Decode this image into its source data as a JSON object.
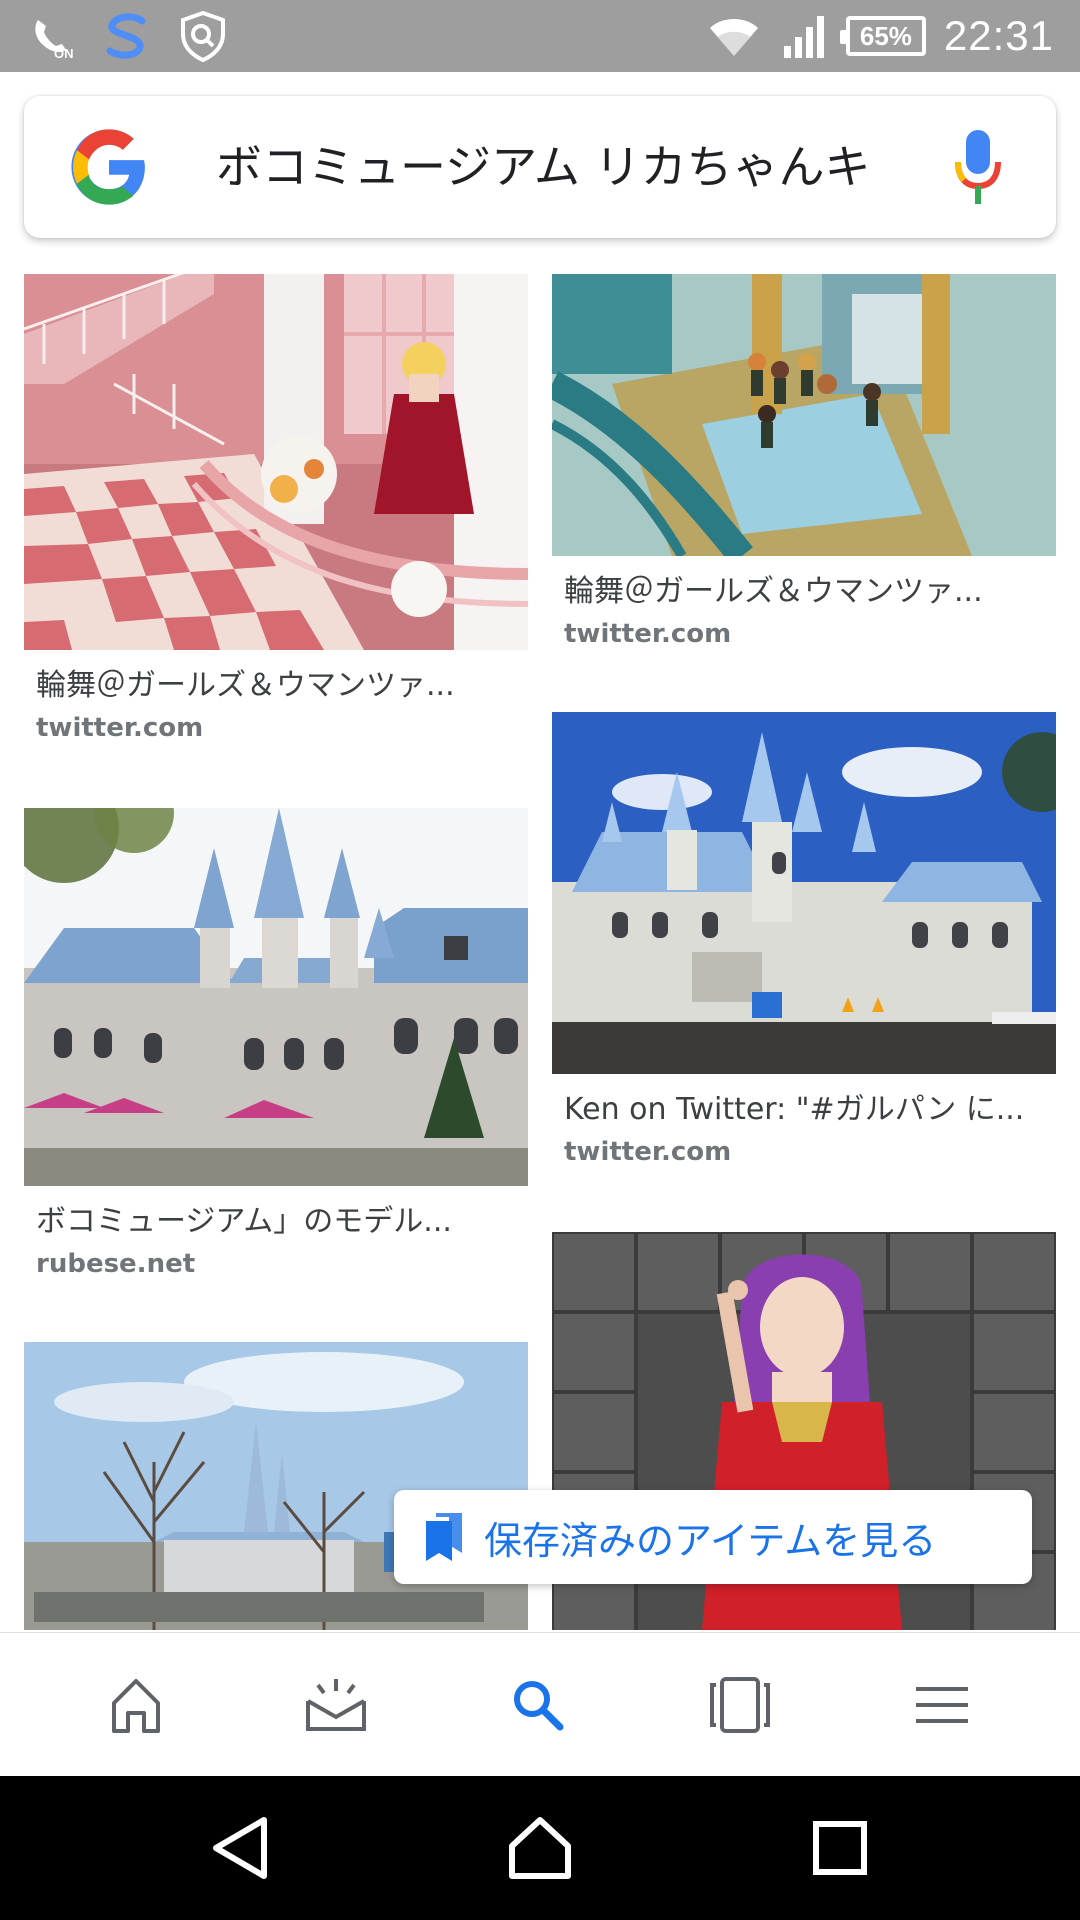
{
  "status_bar": {
    "time": "22:31",
    "battery_percent": "65%",
    "left_icons": [
      "volte-on-icon",
      "s-app-icon",
      "shield-search-icon"
    ],
    "right_icons": [
      "wifi-icon",
      "signal-icon",
      "battery-icon"
    ],
    "background": "#9e9e9e"
  },
  "search": {
    "query": "ボコミュージアム リカちゃんキ",
    "logo": "google-g-logo",
    "mic": "mic-icon"
  },
  "results": [
    {
      "title": "輪舞＠ガールズ＆ウマンツァ...",
      "source": "twitter.com",
      "image": "pink-checkered-lobby-with-doll"
    },
    {
      "title": "輪舞＠ガールズ＆ウマンツァ...",
      "source": "twitter.com",
      "image": "anime-girls-in-lobby"
    },
    {
      "title": "ボコミュージアム」のモデル...",
      "source": "rubese.net",
      "image": "blue-roof-castle-with-umbrellas"
    },
    {
      "title": "Ken on Twitter: \"#ガルパン に...",
      "source": "twitter.com",
      "image": "white-castle-blue-sky"
    },
    {
      "title": "",
      "source": "",
      "image": "castle-with-bare-trees"
    },
    {
      "title": "",
      "source": "",
      "image": "purple-hair-doll-red-dress"
    }
  ],
  "saved_chip": {
    "label": "保存済みのアイテムを見る",
    "icon": "bookmark-icon",
    "color": "#1a73e8"
  },
  "app_nav": {
    "items": [
      "home-icon",
      "updates-icon",
      "search-icon",
      "tabs-icon",
      "menu-icon"
    ],
    "active": "search-icon",
    "active_color": "#1a73e8"
  },
  "system_nav": {
    "items": [
      "back-icon",
      "home-circle-icon",
      "recents-icon"
    ]
  }
}
